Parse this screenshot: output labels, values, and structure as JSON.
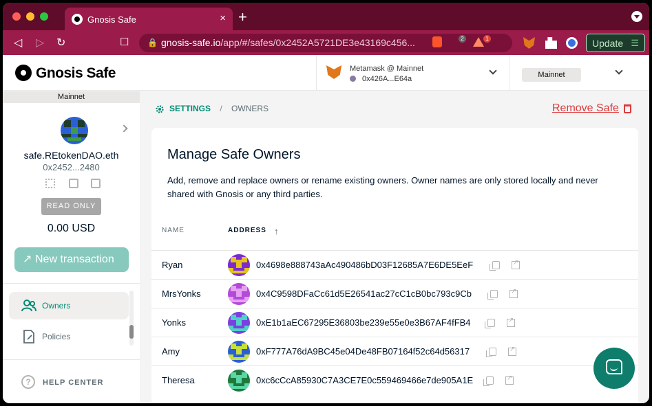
{
  "browser": {
    "tab_title": "Gnosis Safe",
    "tab_close": "×",
    "new_tab": "+",
    "url_host": "gnosis-safe.io",
    "url_rest": "/app/#/safes/0x2452A5721DE3e43169c456...",
    "brave_badge": "2",
    "rewards_badge": "1",
    "update_label": "Update",
    "update_menu": "☰"
  },
  "header": {
    "logo_text": "Gnosis Safe",
    "wallet_name": "Metamask @ Mainnet",
    "wallet_address": "0x426A...E64a",
    "network": "Mainnet"
  },
  "sidebar": {
    "network": "Mainnet",
    "ens_name": "safe.REtokenDAO.eth",
    "address": "0x2452...2480",
    "read_only": "READ ONLY",
    "balance": "0.00 USD",
    "new_tx_icon": "↗",
    "new_tx_label": "New transaction",
    "items": [
      {
        "label": "Owners",
        "active": true
      },
      {
        "label": "Policies",
        "active": false
      }
    ],
    "help_icon": "?",
    "help_label": "HELP CENTER"
  },
  "main": {
    "breadcrumb_settings": "SETTINGS",
    "breadcrumb_sep": "/",
    "breadcrumb_current": "OWNERS",
    "remove_safe": "Remove Safe",
    "card_title": "Manage Safe Owners",
    "card_desc": "Add, remove and replace owners or rename existing owners. Owner names are only stored locally and never shared with Gnosis or any third parties.",
    "col_name": "NAME",
    "col_address": "ADDRESS",
    "sort_arrow": "↑",
    "owners": [
      {
        "name": "Ryan",
        "address": "0x4698e888743aAc490486bD03F12685A7E6DE5EeF",
        "colors": [
          "#7a2bd0",
          "#e8c21a"
        ]
      },
      {
        "name": "MrsYonks",
        "address": "0x4C9598DFaCc61d5E26541ac27cC1cB0bc793c9Cb",
        "colors": [
          "#b34ad8",
          "#e6a2f2"
        ]
      },
      {
        "name": "Yonks",
        "address": "0xE1b1aEC67295E36803be239e55e0e3B67AF4fFB4",
        "colors": [
          "#7b3fe0",
          "#4fd0c9"
        ]
      },
      {
        "name": "Amy",
        "address": "0xF777A76dA9BC45e04De48FB07164f52c64d56317",
        "colors": [
          "#2b5fd6",
          "#c9e03a"
        ]
      },
      {
        "name": "Theresa",
        "address": "0xc6cCcA85930C7A3CE7E0c559469466e7de905A1E",
        "colors": [
          "#1f7a3a",
          "#5ad6a8"
        ]
      }
    ]
  },
  "colors": {
    "accent": "#008c73",
    "danger": "#db3a3d",
    "new_tx": "#88c9bd"
  }
}
